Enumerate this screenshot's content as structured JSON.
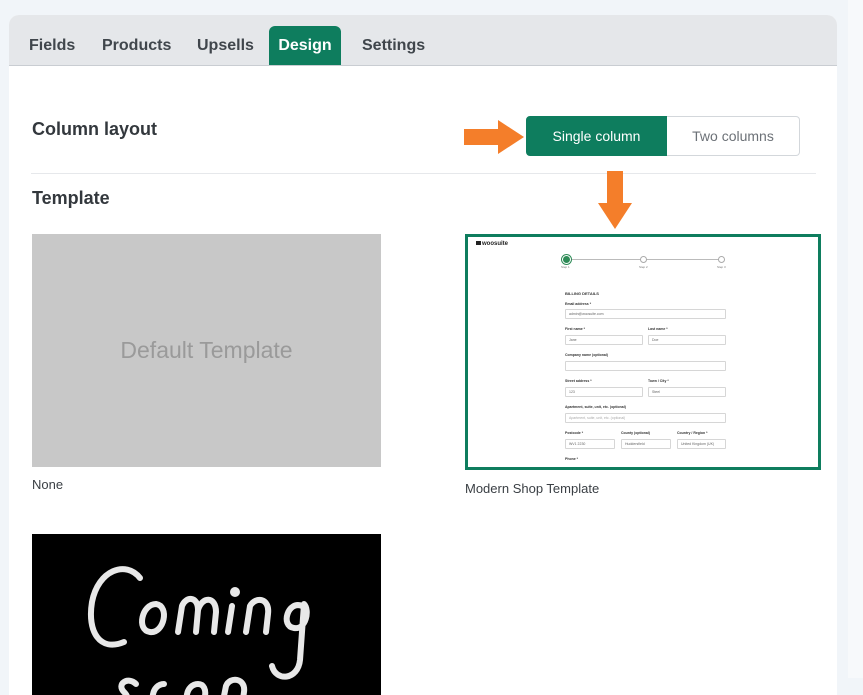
{
  "tabs": [
    {
      "label": "Fields",
      "active": false
    },
    {
      "label": "Products",
      "active": false
    },
    {
      "label": "Upsells",
      "active": false
    },
    {
      "label": "Design",
      "active": true
    },
    {
      "label": "Settings",
      "active": false
    }
  ],
  "column_layout": {
    "title": "Column layout",
    "options": [
      "Single column",
      "Two columns"
    ],
    "selected": "Single column"
  },
  "template": {
    "title": "Template",
    "cards": [
      {
        "image_text": "Default Template",
        "caption": "None"
      },
      {
        "caption": "Modern Shop Template",
        "selected": true
      },
      {
        "image_text": "Coming soon"
      }
    ]
  },
  "preview": {
    "logo": "woosuite",
    "steps": [
      "Step 1",
      "Step 2",
      "Step 3"
    ],
    "heading": "BILLING DETAILS",
    "email_label": "Email address *",
    "email_value": "admin@woosuite.com",
    "first_name_label": "First name *",
    "first_name_value": "Jane",
    "last_name_label": "Last name *",
    "last_name_value": "Doe",
    "company_label": "Company name (optional)",
    "street_label": "Street address *",
    "street_value": "123",
    "town_label": "Town / City *",
    "town_value": "Steel",
    "apartment_label": "Apartment, suite, unit, etc. (optional)",
    "apartment_placeholder": "Apartment, suite, unit, etc. (optional)",
    "postcode_label": "Postcode *",
    "postcode_value": "WV1 2230",
    "county_label": "County (optional)",
    "county_value": "Huddersfield",
    "country_label": "Country / Region *",
    "country_value": "United Kingdom (UK)",
    "phone_label": "Phone *"
  },
  "colors": {
    "accent": "#0e7d5e",
    "arrow": "#f47e2a"
  }
}
